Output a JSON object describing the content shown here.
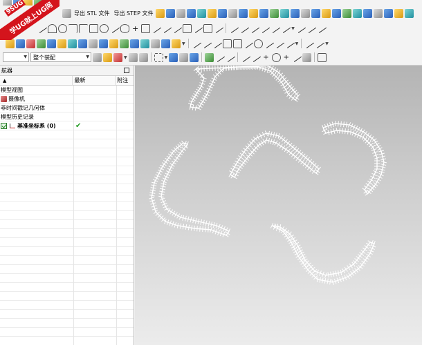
{
  "watermark": {
    "code": "9SUG",
    "text": "学UG就上UG网"
  },
  "toolbar": {
    "export_stl_label": "导出 STL 文件",
    "export_step_label": "导出 STEP 文件",
    "filter_dropdown_value": "",
    "assembly_dropdown_value": "整个装配"
  },
  "navigator": {
    "title": "航器",
    "columns": {
      "name_sort_indicator": "▲",
      "latest": "最新",
      "attached": "附注"
    },
    "rows": [
      {
        "label": "模型视图",
        "icon": "",
        "latest": ""
      },
      {
        "label": "摄像机",
        "icon": "camera-icon",
        "latest": ""
      },
      {
        "label": "非时间戳记几何体",
        "icon": "",
        "latest": ""
      },
      {
        "label": "模型历史记录",
        "icon": "",
        "latest": ""
      },
      {
        "label": "基准坐标系 (0)",
        "icon": "datum-csys-icon",
        "latest": "✔",
        "checked": true
      }
    ]
  },
  "viewport": {
    "background_top": "#b4b4b4",
    "background_bottom": "#ececec",
    "curve_color": "#ffffff"
  }
}
